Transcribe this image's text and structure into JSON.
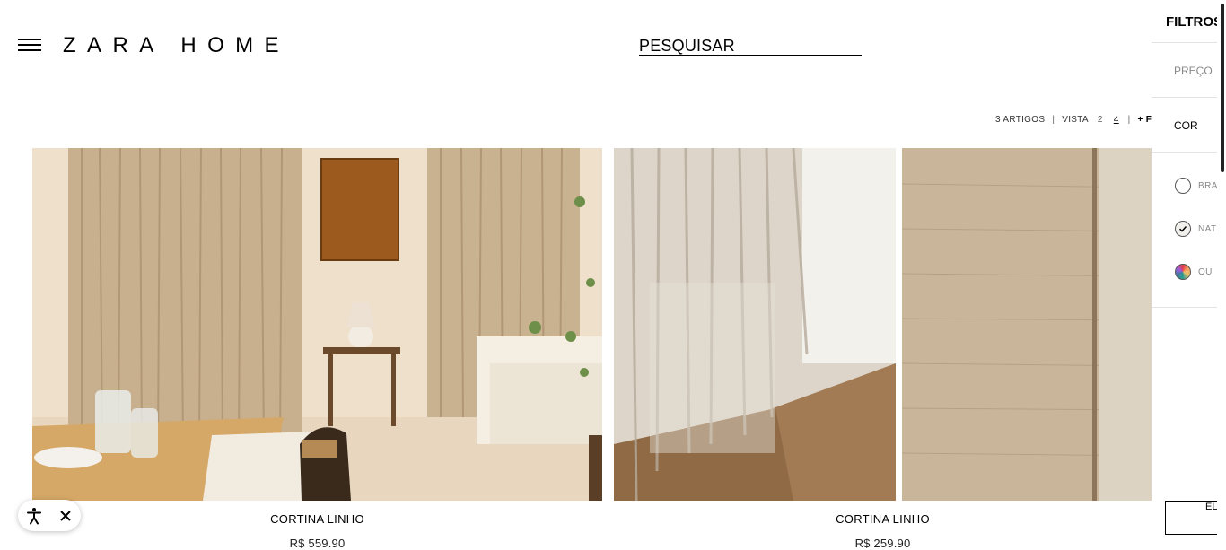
{
  "header": {
    "logo": "ZARA HOME",
    "search_label": "PESQUISAR",
    "menu_icon": "hamburger-menu-icon"
  },
  "toolbar": {
    "count": "3 ARTIGOS",
    "separator": "|",
    "view_label": "VISTA",
    "view_options": [
      "2",
      "4"
    ],
    "active_view": "4",
    "filter_link": "+ FILT"
  },
  "products": [
    {
      "name": "CORTINA LINHO",
      "price": "R$ 559.90"
    },
    {
      "name": "CORTINA LINHO",
      "price": "R$ 259.90"
    }
  ],
  "filters": {
    "title": "FILTROS",
    "sections": {
      "price": "PREÇO",
      "color": "COR"
    },
    "colors": [
      {
        "label": "BRA",
        "checked": false
      },
      {
        "label": "NAT",
        "checked": true
      },
      {
        "label": "OU",
        "checked": false
      }
    ],
    "apply_label": "EL"
  },
  "accessibility": {
    "icon": "accessibility-icon",
    "close_icon": "close-icon"
  },
  "colors": {
    "text": "#000000",
    "muted": "#888888",
    "divider": "#e3e3e3"
  }
}
